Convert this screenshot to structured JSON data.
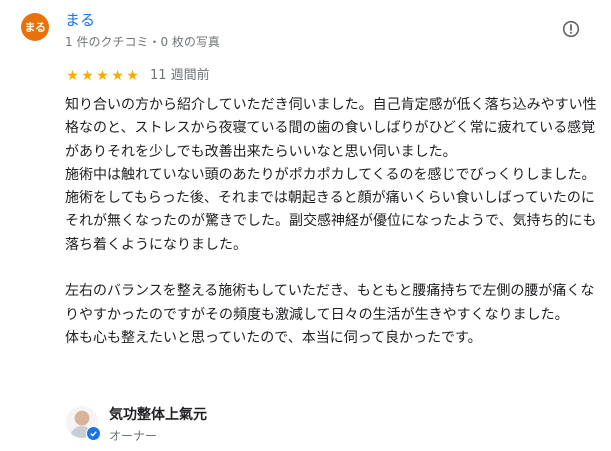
{
  "review": {
    "author_initials": "まる",
    "author_name": "まる",
    "author_meta": "1 件のクチコミ・0 枚の写真",
    "rating": 5,
    "date": "11 週間前",
    "body": "知り合いの方から紹介していただき伺いました。自己肯定感が低く落ち込みやすい性格なのと、ストレスから夜寝ている間の歯の食いしばりがひどく常に疲れている感覚がありそれを少しでも改善出来たらいいなと思い伺いました。\n施術中は触れていない頭のあたりがポカポカしてくるのを感じでびっくりしました。施術をしてもらった後、それまでは朝起きると顔が痛いくらい食いしばっていたのにそれが無くなったのが驚きでした。副交感神経が優位になったようで、気持ち的にも落ち着くようになりました。\n\n左右のバランスを整える施術もしていただき、もともと腰痛持ちで左側の腰が痛くなりやすかったのですがその頻度も激減して日々の生活が生きやすくなりました。\n体も心も整えたいと思っていたので、本当に伺って良かったです。"
  },
  "owner": {
    "name": "気功整体上氣元",
    "role": "オーナー"
  },
  "colors": {
    "avatar_bg": "#e8710a",
    "star": "#f9ab00",
    "link": "#1a73e8"
  },
  "icons": {
    "report": "report-icon",
    "verified": "verified-check-icon",
    "star": "star-icon"
  }
}
